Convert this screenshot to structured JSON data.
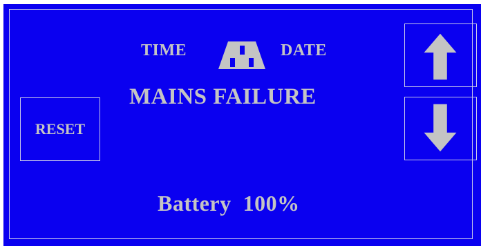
{
  "header": {
    "time_label": "TIME",
    "date_label": "DATE",
    "status_icon": "mains-plug-icon"
  },
  "alarm": {
    "title": "MAINS FAILURE"
  },
  "battery": {
    "label": "Battery",
    "level": "100%"
  },
  "controls": {
    "reset_label": "RESET",
    "up_icon": "arrow-up-icon",
    "down_icon": "arrow-down-icon"
  },
  "colors": {
    "background": "#0a00f0",
    "text": "#c4c4c4",
    "border": "#c8c8e8"
  }
}
